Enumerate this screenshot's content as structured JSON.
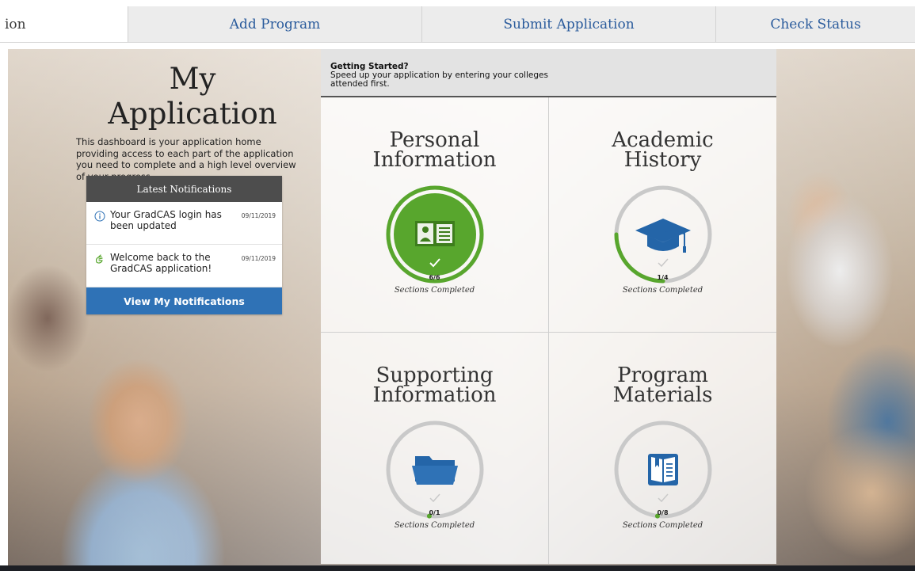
{
  "tabs": [
    {
      "label": "ion",
      "active": true
    },
    {
      "label": "Add Program",
      "active": false
    },
    {
      "label": "Submit Application",
      "active": false
    },
    {
      "label": "Check Status",
      "active": false
    }
  ],
  "left": {
    "title": "My Application",
    "intro": "This dashboard is your application home providing access to each part of the application you need to complete and a high level overview of your progress."
  },
  "notifications": {
    "header": "Latest Notifications",
    "items": [
      {
        "icon": "info-circle-icon",
        "text": "Your GradCAS login has been updated",
        "date": "09/11/2019"
      },
      {
        "icon": "waving-hand-icon",
        "text": "Welcome back to the GradCAS application!",
        "date": "09/11/2019"
      }
    ],
    "button": "View My Notifications"
  },
  "getting_started": {
    "title": "Getting Started?",
    "body": "Speed up your application by entering your colleges attended first."
  },
  "sections": [
    {
      "title_line1": "Personal",
      "title_line2": "Information",
      "count": "6/6",
      "caption": "Sections Completed",
      "progress": 1.0,
      "icon": "id-card-icon"
    },
    {
      "title_line1": "Academic",
      "title_line2": "History",
      "count": "1/4",
      "caption": "Sections Completed",
      "progress": 0.25,
      "icon": "graduation-cap-icon"
    },
    {
      "title_line1": "Supporting",
      "title_line2": "Information",
      "count": "0/1",
      "caption": "Sections Completed",
      "progress": 0.0,
      "icon": "folder-icon"
    },
    {
      "title_line1": "Program",
      "title_line2": "Materials",
      "count": "0/8",
      "caption": "Sections Completed",
      "progress": 0.0,
      "icon": "book-icon"
    }
  ],
  "colors": {
    "accent_green": "#58a62d",
    "brand_blue": "#2f72b6",
    "icon_blue": "#2465a8",
    "ring_gray": "#c9c9c9"
  }
}
